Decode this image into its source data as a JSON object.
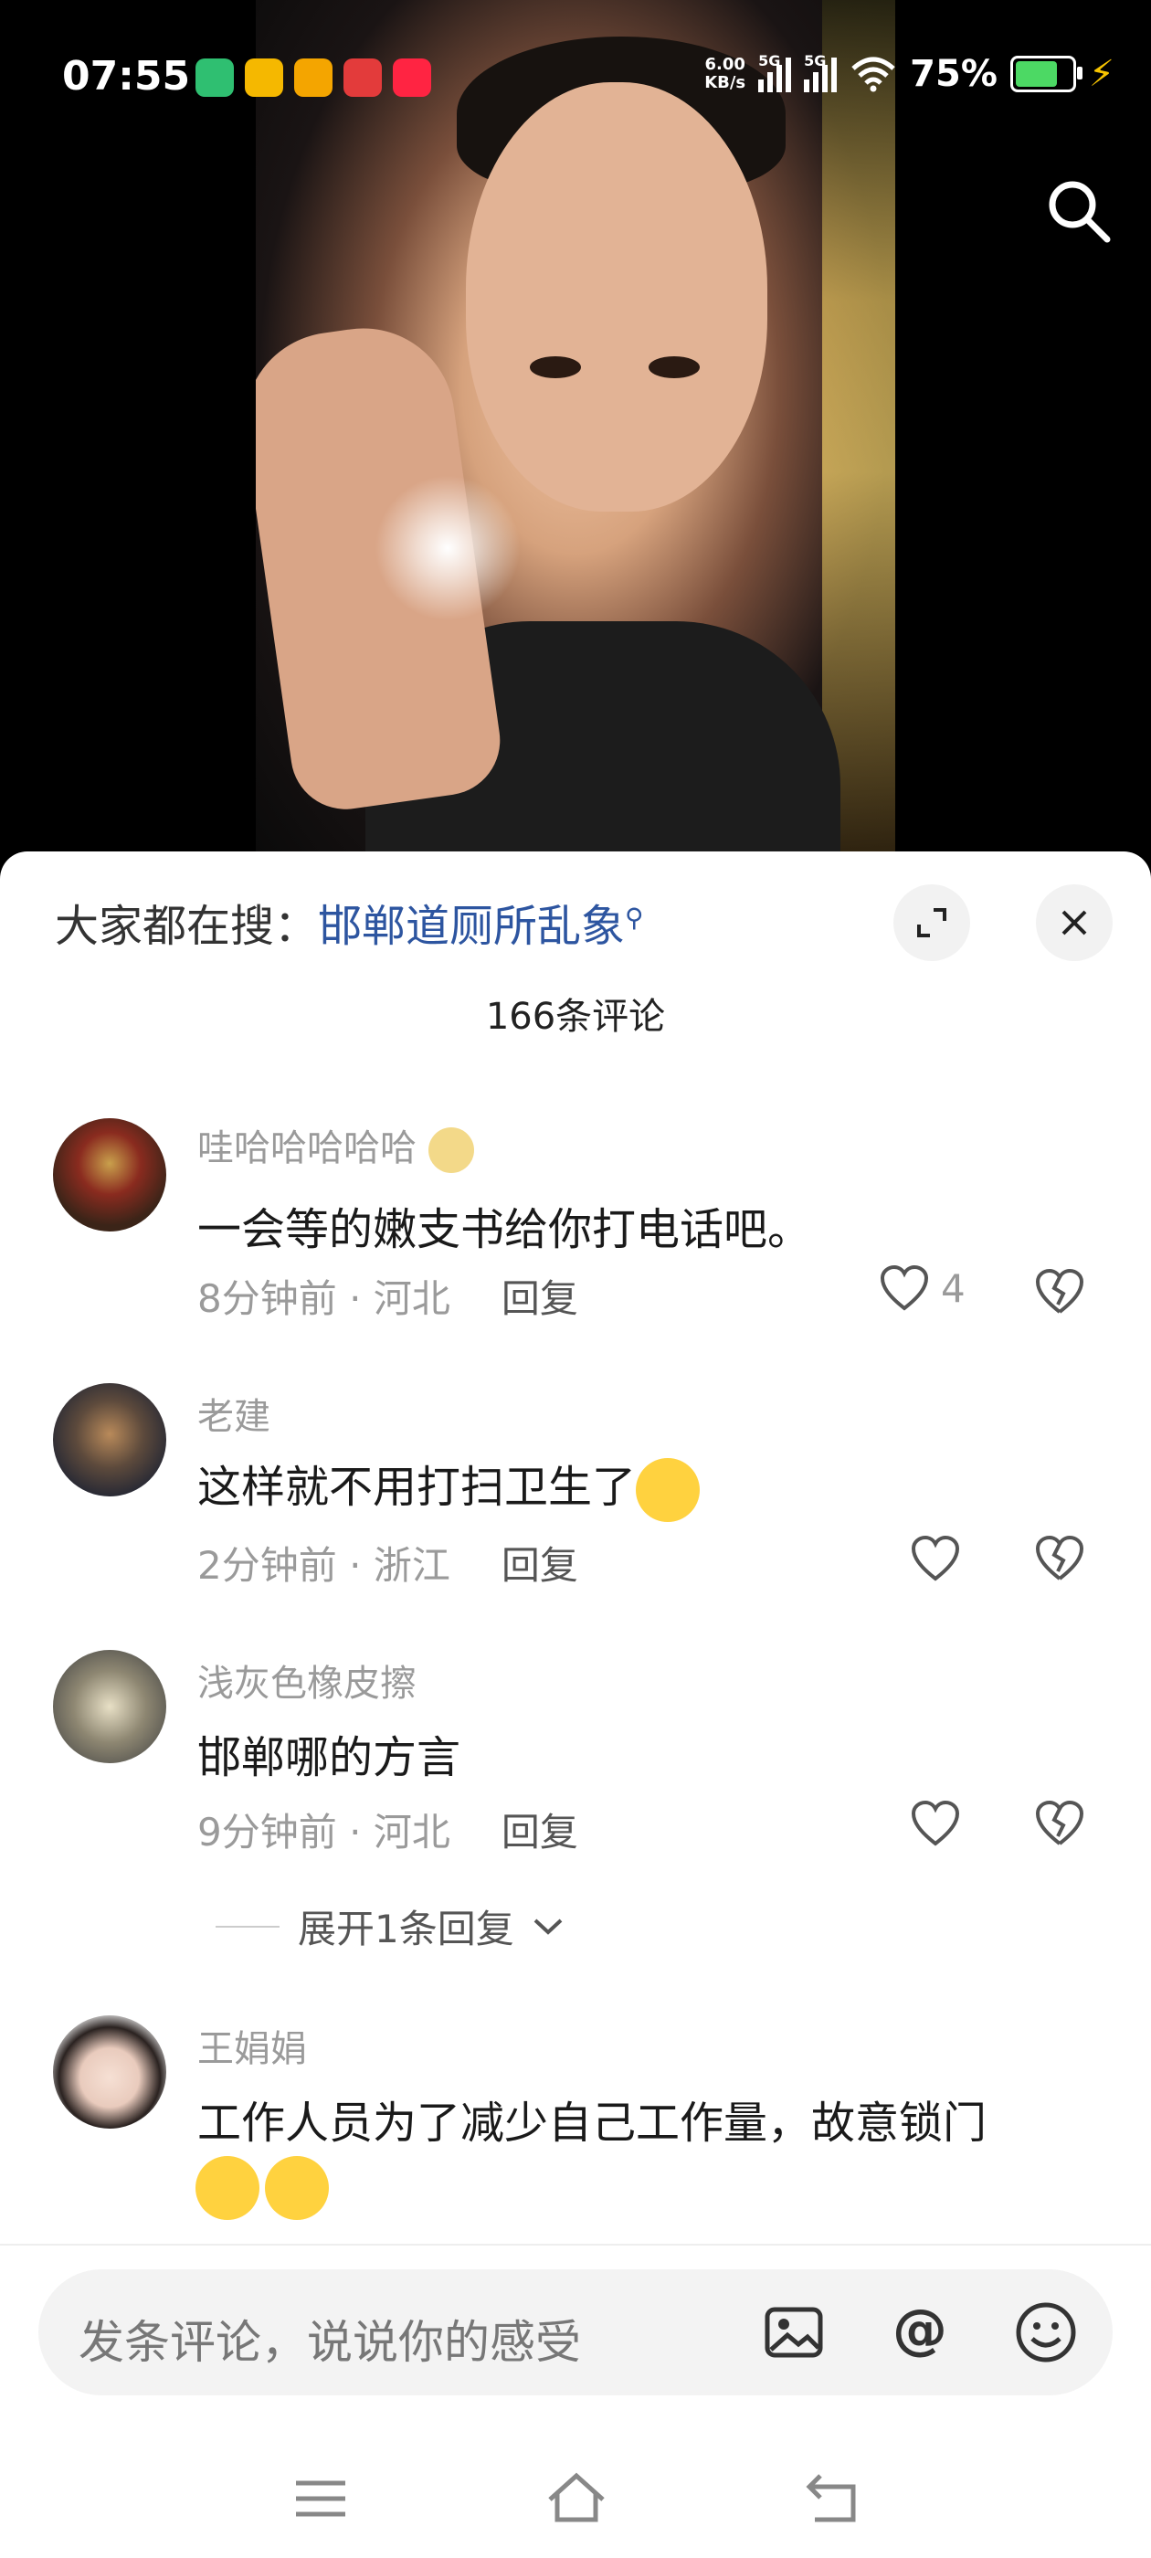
{
  "status": {
    "time": "07:55",
    "net_speed_value": "6.00",
    "net_speed_unit": "KB/s",
    "signal1_label": "5G",
    "signal2_label": "5G",
    "battery_percent": "75%",
    "battery_level": 0.75,
    "app_icons": [
      "wechat-like-icon",
      "sohu-icon",
      "weibo-icon",
      "toutiao-icon",
      "xiaohongshu-icon"
    ]
  },
  "panel": {
    "hot_search_prefix": "大家都在搜：",
    "hot_search_topic": "邯郸道厕所乱象",
    "comment_count": "166条评论"
  },
  "comments": [
    {
      "user": "哇哈哈哈哈哈",
      "user_emoji": "grin-emoji",
      "text": "一会等的嫩支书给你打电话吧。",
      "time": "8分钟前",
      "sep": "·",
      "location": "河北",
      "reply_label": "回复",
      "likes": "4"
    },
    {
      "user": "老建",
      "text": "这样就不用打扫卫生了",
      "text_emoji": "laugh-cry-emoji",
      "time": "2分钟前",
      "sep": "·",
      "location": "浙江",
      "reply_label": "回复"
    },
    {
      "user": "浅灰色橡皮擦",
      "text": "邯郸哪的方言",
      "time": "9分钟前",
      "sep": "·",
      "location": "河北",
      "reply_label": "回复",
      "expand_label": "展开1条回复"
    },
    {
      "user": "王娟娟",
      "text": "工作人员为了减少自己工作量，故意锁门",
      "text_emoji": "thinking-emoji"
    }
  ],
  "input": {
    "placeholder": "发条评论，说说你的感受"
  },
  "colors": {
    "topic": "#2d55a0",
    "battery": "#4cd964",
    "charging": "#f7c400"
  }
}
